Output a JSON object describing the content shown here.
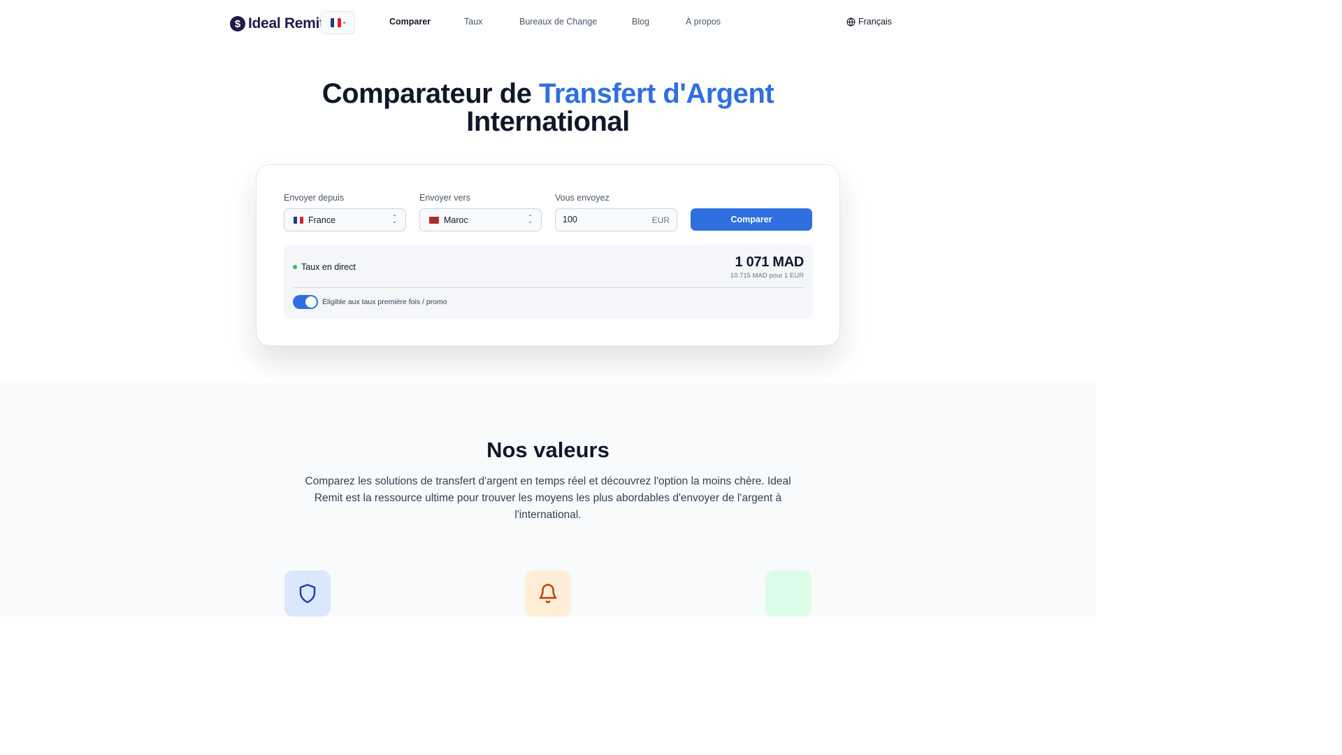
{
  "brand": {
    "name": "Ideal Remit",
    "logo_symbol": "$",
    "color": "#1e1b4b"
  },
  "nav": {
    "items": [
      {
        "label": "Comparer",
        "active": true
      },
      {
        "label": "Taux",
        "active": false
      },
      {
        "label": "Bureaux de Change",
        "active": false
      },
      {
        "label": "Blog",
        "active": false
      },
      {
        "label": "À propos",
        "active": false
      }
    ],
    "language": "Français"
  },
  "hero": {
    "title_prefix": "Comparateur de",
    "title_accent": "Transfert d'Argent",
    "title_suffix": "International",
    "accent_color": "#2f6fe0"
  },
  "form": {
    "from": {
      "label": "Envoyer depuis",
      "value": "France",
      "flag_icon": "france-flag-icon"
    },
    "to": {
      "label": "Envoyer vers",
      "value": "Maroc",
      "flag_icon": "morocco-flag-icon"
    },
    "amount": {
      "label": "Vous envoyez",
      "value": "100",
      "currency": "EUR"
    },
    "submit_label": "Comparer"
  },
  "rate": {
    "status": "Taux en direct",
    "result": "1 071 MAD",
    "detail": "10.715 MAD pour 1 EUR",
    "promo_label": "Éligible aux taux première fois / promo",
    "promo_enabled": true
  },
  "values_section": {
    "title": "Nos valeurs",
    "description": "Comparez les solutions de transfert d'argent en temps réel et découvrez l'option la moins chère. Ideal Remit est la ressource ultime pour trouver les moyens les plus abordables d'envoyer de l'argent à l'international.",
    "features": [
      {
        "icon": "shield-icon",
        "color": "#1e40af",
        "bg": "#dbe7fd"
      },
      {
        "icon": "bell-icon",
        "color": "#c2410c",
        "bg": "#feeed7"
      },
      {
        "icon": "unknown-icon",
        "bg": "#dcfce7"
      }
    ]
  }
}
